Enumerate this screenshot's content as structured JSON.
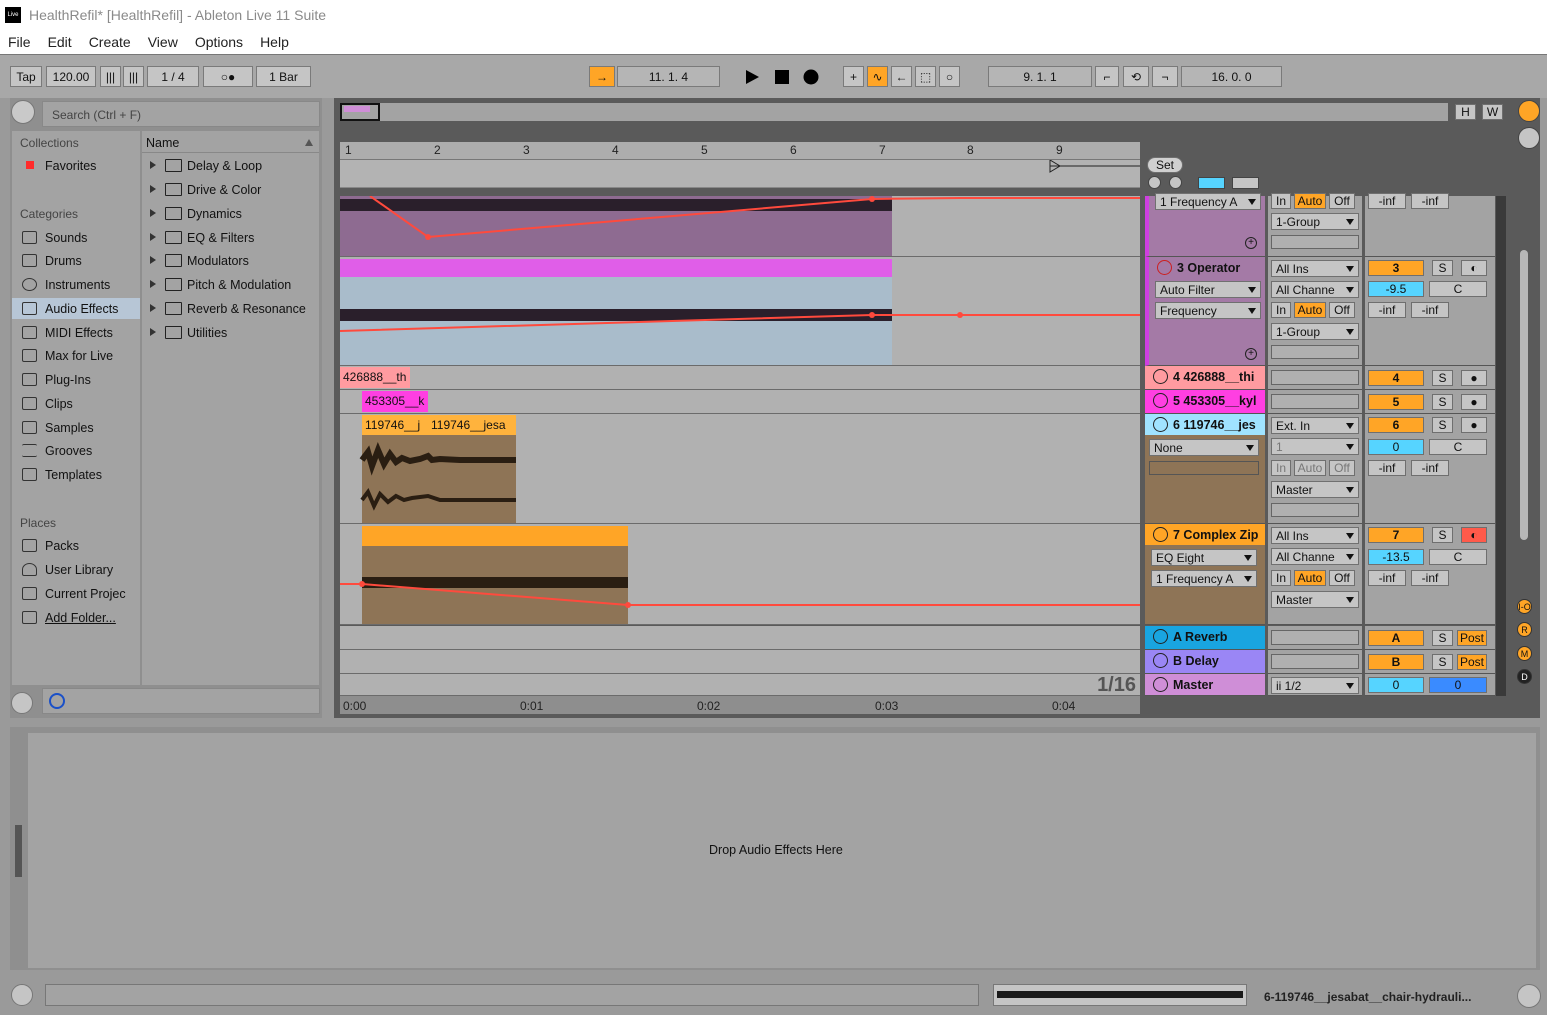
{
  "window": {
    "title": "HealthRefil*  [HealthRefil] - Ableton Live 11 Suite",
    "logo_text": "Live"
  },
  "menu": [
    "File",
    "Edit",
    "Create",
    "View",
    "Options",
    "Help"
  ],
  "transport": {
    "tap": "Tap",
    "tempo": "120.00",
    "signature": "1 / 4",
    "metro": "○●",
    "quantize": "1 Bar",
    "position": "11.   1.   4",
    "loop_start": "9.   1.   1",
    "loop_length": "16.   0.   0"
  },
  "browser": {
    "search_placeholder": "Search (Ctrl + F)",
    "collections_header": "Collections",
    "favorites": "Favorites",
    "categories_header": "Categories",
    "categories": [
      "Sounds",
      "Drums",
      "Instruments",
      "Audio Effects",
      "MIDI Effects",
      "Max for Live",
      "Plug-Ins",
      "Clips",
      "Samples",
      "Grooves",
      "Templates"
    ],
    "places_header": "Places",
    "places": [
      "Packs",
      "User Library",
      "Current Projec",
      "Add Folder..."
    ],
    "name_header": "Name",
    "folders": [
      "Delay & Loop",
      "Drive & Color",
      "Dynamics",
      "EQ & Filters",
      "Modulators",
      "Pitch & Modulation",
      "Reverb & Resonance",
      "Utilities"
    ]
  },
  "arrangement": {
    "bars": [
      "1",
      "2",
      "3",
      "4",
      "5",
      "6",
      "7",
      "8",
      "9"
    ],
    "set_label": "Set",
    "hw": [
      "H",
      "W"
    ],
    "time_labels": [
      "0:00",
      "0:01",
      "0:02",
      "0:03",
      "0:04"
    ],
    "grid": "1/16",
    "clips": {
      "c4": "426888__th",
      "c5": "453305__k",
      "c6a": "119746__j",
      "c6b": "119746__jesa"
    }
  },
  "tracks": [
    {
      "name": "",
      "color": "#a47aa6",
      "dev1": "1 Frequency A",
      "io_in": "",
      "io_out": "1-Group"
    },
    {
      "name": "3 Operator",
      "color": "#a47aa6",
      "dev1": "Auto Filter",
      "dev2": "Frequency",
      "in1": "All Ins",
      "in2": "All Channe",
      "out": "1-Group",
      "num": "3",
      "vol": "-9.5",
      "pan": "C",
      "inf1": "-inf",
      "inf2": "-inf"
    },
    {
      "name": "4 426888__thi",
      "color": "#ff9ba0",
      "num": "4"
    },
    {
      "name": "5 453305__kyl",
      "color": "#ff3fe2",
      "num": "5"
    },
    {
      "name": "6 119746__jes",
      "color": "#a0e3ff",
      "dev1": "None",
      "in1": "Ext. In",
      "in2": "1",
      "out": "Master",
      "num": "6",
      "vol": "0",
      "pan": "C",
      "inf1": "-inf",
      "inf2": "-inf"
    },
    {
      "name": "7 Complex Zip",
      "color": "#ffa526",
      "dev1": "EQ Eight",
      "dev2": "1 Frequency A",
      "in1": "All Ins",
      "in2": "All Channe",
      "out": "Master",
      "num": "7",
      "vol": "-13.5",
      "pan": "C",
      "inf1": "-inf",
      "inf2": "-inf"
    },
    {
      "name": "A Reverb",
      "color": "#19a5e0",
      "num": "A",
      "post": "Post"
    },
    {
      "name": "B Delay",
      "color": "#9a86f5",
      "num": "B",
      "post": "Post"
    },
    {
      "name": "Master",
      "color": "#cf8ed7",
      "out": "ii 1/2",
      "vol": "0",
      "vol2": "0"
    }
  ],
  "mixer_labels": {
    "in": "In",
    "auto": "Auto",
    "off": "Off",
    "solo": "S"
  },
  "side_circles": [
    "I-O",
    "R",
    "M",
    "D"
  ],
  "detail": {
    "drop_text": "Drop Audio Effects Here"
  },
  "status": {
    "selected": "6-119746__jesabat__chair-hydrauli..."
  }
}
